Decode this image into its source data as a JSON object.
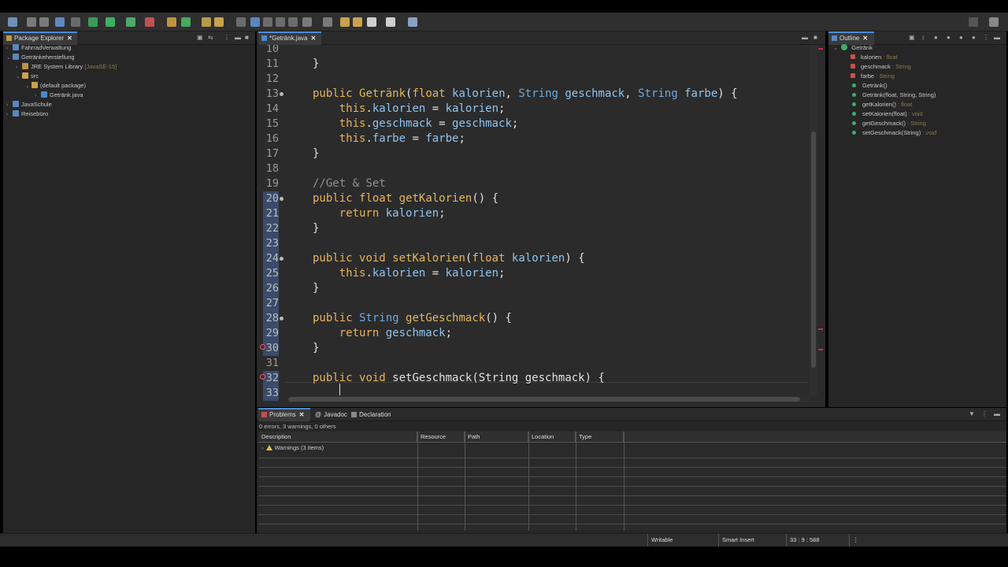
{
  "package_explorer": {
    "title": "Package Explorer",
    "items": [
      {
        "label": "FahrradVerwaltung",
        "deco": ""
      },
      {
        "label": "Getränkeherstellung",
        "deco": ""
      },
      {
        "label": "JRE System Library",
        "deco": "[JavaSE-15]"
      },
      {
        "label": "src",
        "deco": ""
      },
      {
        "label": "(default package)",
        "deco": ""
      },
      {
        "label": "Getränk.java",
        "deco": ""
      },
      {
        "label": "JavaSchule",
        "deco": ""
      },
      {
        "label": "Reisebüro",
        "deco": ""
      }
    ]
  },
  "editor": {
    "tab_label": "*Getränk.java",
    "line_numbers": [
      "10",
      "11",
      "12",
      "13",
      "14",
      "15",
      "16",
      "17",
      "18",
      "19",
      "20",
      "21",
      "22",
      "23",
      "24",
      "25",
      "26",
      "27",
      "28",
      "29",
      "30",
      "31",
      "32",
      "33"
    ]
  },
  "outline": {
    "title": "Outline",
    "root": "Getränk",
    "members": [
      {
        "name": "kalorien",
        "type": ": float"
      },
      {
        "name": "geschmack",
        "type": ": String"
      },
      {
        "name": "farbe",
        "type": ": String"
      },
      {
        "name": "Getränk()",
        "type": ""
      },
      {
        "name": "Getränk(float, String, String)",
        "type": ""
      },
      {
        "name": "getKalorien()",
        "type": ": float"
      },
      {
        "name": "setKalorien(float)",
        "type": ": void"
      },
      {
        "name": "getGeschmack()",
        "type": ": String"
      },
      {
        "name": "setGeschmack(String)",
        "type": ": void"
      }
    ]
  },
  "problems": {
    "tabs": [
      "Problems",
      "Javadoc",
      "Declaration"
    ],
    "summary": "0 errors, 3 warnings, 0 others",
    "columns": [
      "Description",
      "Resource",
      "Path",
      "Location",
      "Type"
    ],
    "warning_row": "Warnings (3 items)"
  },
  "status": {
    "writable": "Writable",
    "insert_mode": "Smart Insert",
    "position": "33 : 9 : 588"
  },
  "colors": {
    "accent": "#4c8cd6",
    "keyword": "#e8b35a",
    "type": "#6fa8dc",
    "field": "#8fc4f0",
    "comment": "#909090"
  }
}
